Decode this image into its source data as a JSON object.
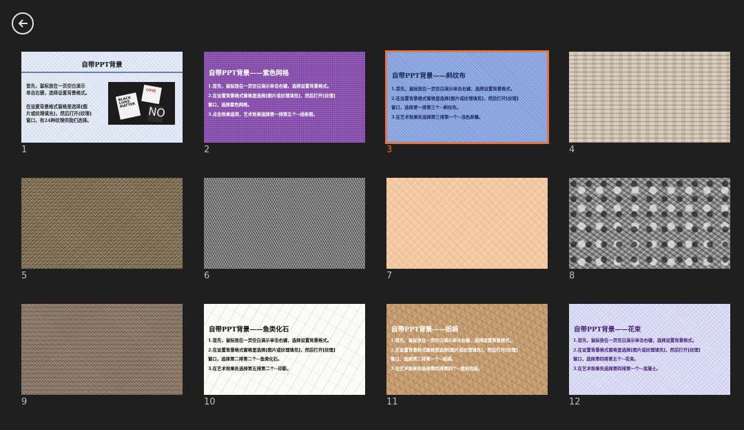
{
  "toolbar": {
    "back_icon": "back-arrow-icon"
  },
  "accent_color": "#e0764e",
  "selected_slide": 3,
  "slides": [
    {
      "number": "1",
      "title": "自带PPT背景",
      "lines": [
        "首先，鼠标放在一页空白演示",
        "单击右键，选择设置背景格式。",
        "",
        "在设置背景格式窗格里选择[图",
        "片或纹理填充]，然后打开[纹理]",
        "窗口，有24种纹理供我们选择。"
      ],
      "photo_cards": [
        "BLACK LIVES MATTER",
        "LOVE",
        "NO"
      ]
    },
    {
      "number": "2",
      "title": "自带PPT背景——紫色网格",
      "lines": [
        "1.首先，鼠标放在一页空白演示单击右键，选择设置背景格式。",
        "2.在设置背景格式窗格里选择[图片或纹理填充]，然后打开[纹理]",
        "窗口，选择紫色网格。",
        "3.点击效果选项，艺术效果选择第一排第五个--线条图。"
      ]
    },
    {
      "number": "3",
      "title": "自带PPT背景——斜纹布",
      "lines": [
        "1.首先，鼠标放在一页空白演示单击右键，选择设置背景格式。",
        "2.在设置背景格式窗格里选择[图片或纹理填充]，然后打开[纹理]",
        "窗口，选择第一排第三个--斜纹布。",
        "3.在艺术效果处选择第三排第一个--浅色屏幕。"
      ]
    },
    {
      "number": "4"
    },
    {
      "number": "5"
    },
    {
      "number": "6"
    },
    {
      "number": "7"
    },
    {
      "number": "8"
    },
    {
      "number": "9"
    },
    {
      "number": "10",
      "title": "自带PPT背景——鱼类化石",
      "lines": [
        "1.首先，鼠标放在一页空白演示单击右键，选择设置背景格式。",
        " 2.在设置背景格式窗格里选择[图片或纹理填充]，然后打开[纹理]",
        "窗口，选择第二排第二个--鱼类化石。",
        "3.在艺术效果处选择第五排第二个--印影。"
      ]
    },
    {
      "number": "11",
      "title": "自带PPT背景——纸袋",
      "lines": [
        "1.首先，鼠标放在一页空白演示单击右键，选择设置背景格式。",
        "2.在设置背景格式窗格里选择[图片或纹理填充]，然后打开[纹理]",
        "窗口，选择第二排第一个--纸袋。",
        "3.在艺术效果处选择第四排第四个--塑封包装。"
      ]
    },
    {
      "number": "12",
      "title": "自带PPT背景——花束",
      "lines": [
        "1.首先，鼠标放在一页空白演示单击右键，选择设置背景格式。",
        " 2.在设置背景格式窗格里选择[图片或纹理填充]，然后打开[纹理]",
        "窗口，选择第四排第五个--花束。",
        "3.在艺术效果处选择第四排第一个--混凝土。"
      ]
    }
  ]
}
